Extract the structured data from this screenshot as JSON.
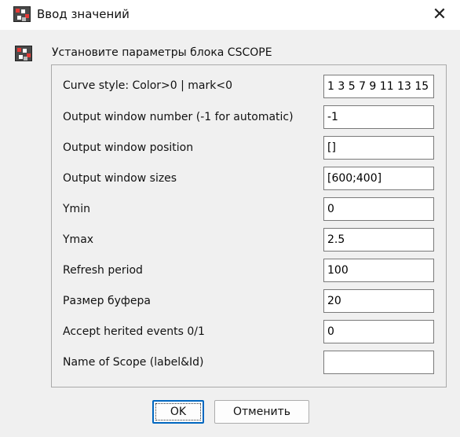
{
  "window": {
    "title": "Ввод значений",
    "icons": {
      "app": "scilab-block-icon",
      "close": "close-icon"
    }
  },
  "dialog": {
    "header": "Установите параметры блока CSCOPE",
    "fields": [
      {
        "label": "Curve style: Color>0 | mark<0",
        "value": "1 3 5 7 9 11 13 15"
      },
      {
        "label": "Output window number (-1 for automatic)",
        "value": "-1"
      },
      {
        "label": "Output window position",
        "value": "[]"
      },
      {
        "label": "Output window sizes",
        "value": "[600;400]"
      },
      {
        "label": "Ymin",
        "value": "0"
      },
      {
        "label": "Ymax",
        "value": "2.5"
      },
      {
        "label": "Refresh period",
        "value": "100"
      },
      {
        "label": "Размер буфера",
        "value": "20"
      },
      {
        "label": "Accept herited events 0/1",
        "value": "0"
      },
      {
        "label": "Name of Scope (label&Id)",
        "value": ""
      }
    ]
  },
  "buttons": {
    "ok": "OK",
    "cancel": "Отменить"
  }
}
